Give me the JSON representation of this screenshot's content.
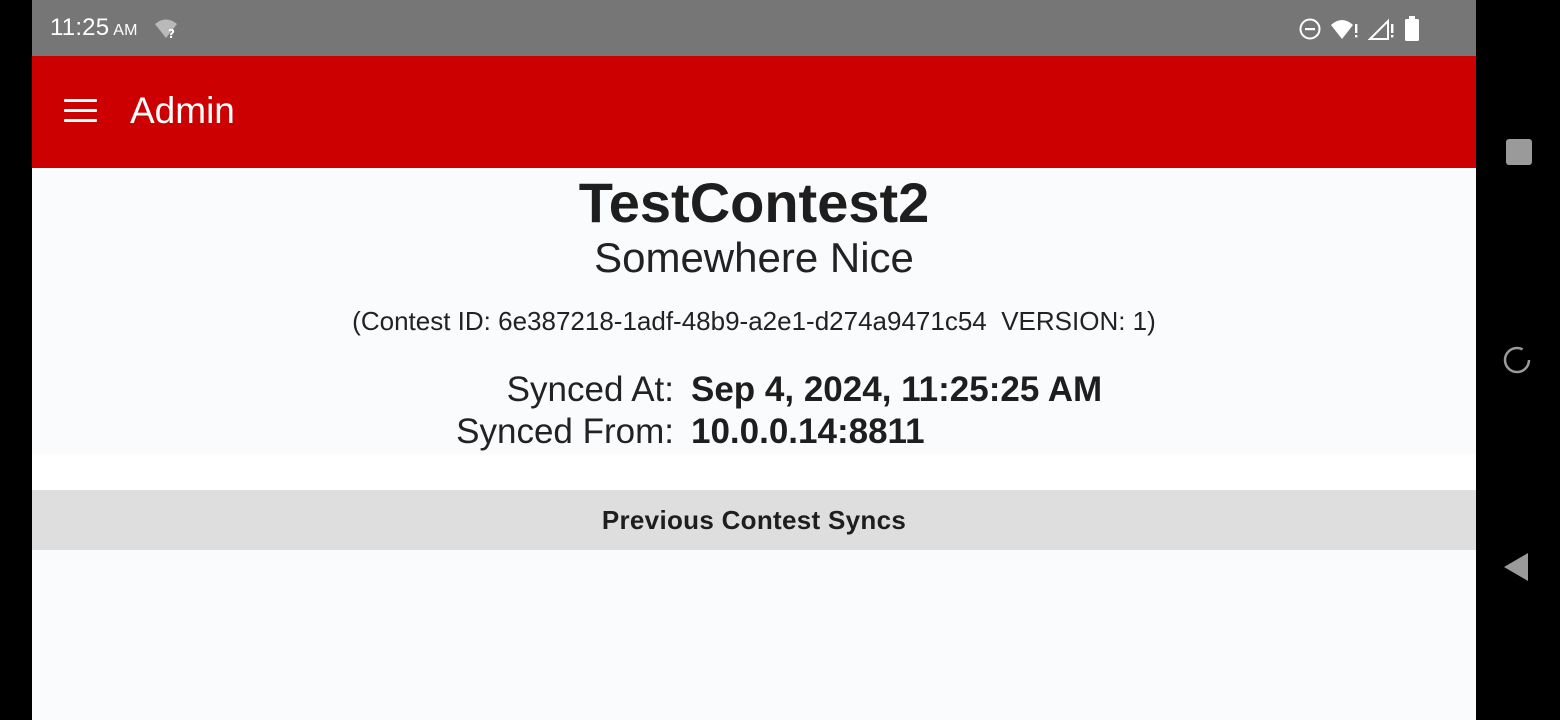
{
  "status_bar": {
    "time": "11:25",
    "ampm": "AM",
    "icons": [
      "wifi-unknown-icon",
      "do-not-disturb-icon",
      "wifi-alert-icon",
      "signal-alert-icon",
      "battery-icon"
    ]
  },
  "app_bar": {
    "menu_icon": "hamburger-menu-icon",
    "title": "Admin",
    "color": "#cc0000"
  },
  "contest": {
    "name": "TestContest2",
    "location": "Somewhere Nice",
    "meta": "(Contest ID: 6e387218-1adf-48b9-a2e1-d274a9471c54  VERSION: 1)"
  },
  "sync": {
    "at_label": "Synced At:",
    "at_value": "Sep 4, 2024, 11:25:25 AM",
    "from_label": "Synced From:",
    "from_value": "10.0.0.14:8811"
  },
  "previous_syncs": {
    "header": "Previous Contest Syncs",
    "items": []
  },
  "nav_bar": {
    "buttons": [
      "recents-square-icon",
      "home-circle-icon",
      "back-triangle-icon"
    ]
  }
}
